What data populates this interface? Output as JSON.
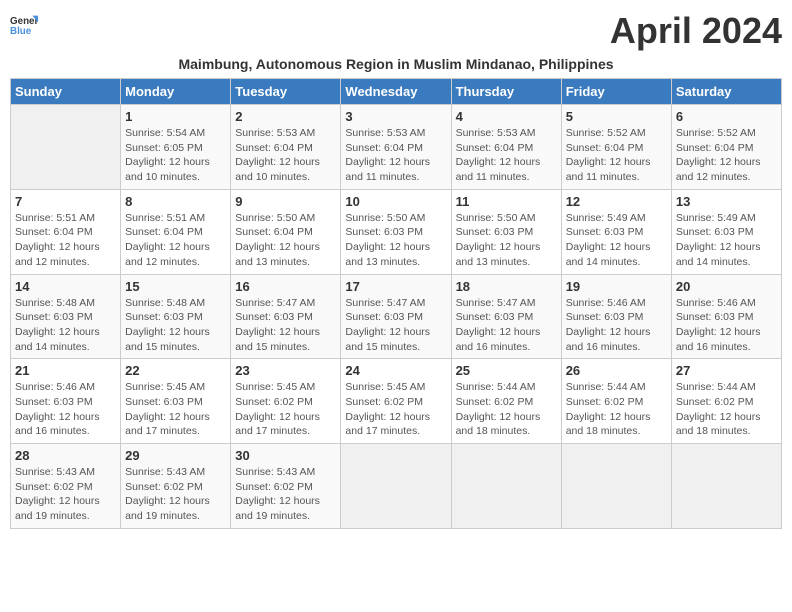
{
  "logo": {
    "line1": "General",
    "line2": "Blue"
  },
  "title": "April 2024",
  "subtitle": "Maimbung, Autonomous Region in Muslim Mindanao, Philippines",
  "days_header": [
    "Sunday",
    "Monday",
    "Tuesday",
    "Wednesday",
    "Thursday",
    "Friday",
    "Saturday"
  ],
  "weeks": [
    [
      {
        "day": "",
        "sunrise": "",
        "sunset": "",
        "daylight": ""
      },
      {
        "day": "1",
        "sunrise": "Sunrise: 5:54 AM",
        "sunset": "Sunset: 6:05 PM",
        "daylight": "Daylight: 12 hours and 10 minutes."
      },
      {
        "day": "2",
        "sunrise": "Sunrise: 5:53 AM",
        "sunset": "Sunset: 6:04 PM",
        "daylight": "Daylight: 12 hours and 10 minutes."
      },
      {
        "day": "3",
        "sunrise": "Sunrise: 5:53 AM",
        "sunset": "Sunset: 6:04 PM",
        "daylight": "Daylight: 12 hours and 11 minutes."
      },
      {
        "day": "4",
        "sunrise": "Sunrise: 5:53 AM",
        "sunset": "Sunset: 6:04 PM",
        "daylight": "Daylight: 12 hours and 11 minutes."
      },
      {
        "day": "5",
        "sunrise": "Sunrise: 5:52 AM",
        "sunset": "Sunset: 6:04 PM",
        "daylight": "Daylight: 12 hours and 11 minutes."
      },
      {
        "day": "6",
        "sunrise": "Sunrise: 5:52 AM",
        "sunset": "Sunset: 6:04 PM",
        "daylight": "Daylight: 12 hours and 12 minutes."
      }
    ],
    [
      {
        "day": "7",
        "sunrise": "Sunrise: 5:51 AM",
        "sunset": "Sunset: 6:04 PM",
        "daylight": "Daylight: 12 hours and 12 minutes."
      },
      {
        "day": "8",
        "sunrise": "Sunrise: 5:51 AM",
        "sunset": "Sunset: 6:04 PM",
        "daylight": "Daylight: 12 hours and 12 minutes."
      },
      {
        "day": "9",
        "sunrise": "Sunrise: 5:50 AM",
        "sunset": "Sunset: 6:04 PM",
        "daylight": "Daylight: 12 hours and 13 minutes."
      },
      {
        "day": "10",
        "sunrise": "Sunrise: 5:50 AM",
        "sunset": "Sunset: 6:03 PM",
        "daylight": "Daylight: 12 hours and 13 minutes."
      },
      {
        "day": "11",
        "sunrise": "Sunrise: 5:50 AM",
        "sunset": "Sunset: 6:03 PM",
        "daylight": "Daylight: 12 hours and 13 minutes."
      },
      {
        "day": "12",
        "sunrise": "Sunrise: 5:49 AM",
        "sunset": "Sunset: 6:03 PM",
        "daylight": "Daylight: 12 hours and 14 minutes."
      },
      {
        "day": "13",
        "sunrise": "Sunrise: 5:49 AM",
        "sunset": "Sunset: 6:03 PM",
        "daylight": "Daylight: 12 hours and 14 minutes."
      }
    ],
    [
      {
        "day": "14",
        "sunrise": "Sunrise: 5:48 AM",
        "sunset": "Sunset: 6:03 PM",
        "daylight": "Daylight: 12 hours and 14 minutes."
      },
      {
        "day": "15",
        "sunrise": "Sunrise: 5:48 AM",
        "sunset": "Sunset: 6:03 PM",
        "daylight": "Daylight: 12 hours and 15 minutes."
      },
      {
        "day": "16",
        "sunrise": "Sunrise: 5:47 AM",
        "sunset": "Sunset: 6:03 PM",
        "daylight": "Daylight: 12 hours and 15 minutes."
      },
      {
        "day": "17",
        "sunrise": "Sunrise: 5:47 AM",
        "sunset": "Sunset: 6:03 PM",
        "daylight": "Daylight: 12 hours and 15 minutes."
      },
      {
        "day": "18",
        "sunrise": "Sunrise: 5:47 AM",
        "sunset": "Sunset: 6:03 PM",
        "daylight": "Daylight: 12 hours and 16 minutes."
      },
      {
        "day": "19",
        "sunrise": "Sunrise: 5:46 AM",
        "sunset": "Sunset: 6:03 PM",
        "daylight": "Daylight: 12 hours and 16 minutes."
      },
      {
        "day": "20",
        "sunrise": "Sunrise: 5:46 AM",
        "sunset": "Sunset: 6:03 PM",
        "daylight": "Daylight: 12 hours and 16 minutes."
      }
    ],
    [
      {
        "day": "21",
        "sunrise": "Sunrise: 5:46 AM",
        "sunset": "Sunset: 6:03 PM",
        "daylight": "Daylight: 12 hours and 16 minutes."
      },
      {
        "day": "22",
        "sunrise": "Sunrise: 5:45 AM",
        "sunset": "Sunset: 6:03 PM",
        "daylight": "Daylight: 12 hours and 17 minutes."
      },
      {
        "day": "23",
        "sunrise": "Sunrise: 5:45 AM",
        "sunset": "Sunset: 6:02 PM",
        "daylight": "Daylight: 12 hours and 17 minutes."
      },
      {
        "day": "24",
        "sunrise": "Sunrise: 5:45 AM",
        "sunset": "Sunset: 6:02 PM",
        "daylight": "Daylight: 12 hours and 17 minutes."
      },
      {
        "day": "25",
        "sunrise": "Sunrise: 5:44 AM",
        "sunset": "Sunset: 6:02 PM",
        "daylight": "Daylight: 12 hours and 18 minutes."
      },
      {
        "day": "26",
        "sunrise": "Sunrise: 5:44 AM",
        "sunset": "Sunset: 6:02 PM",
        "daylight": "Daylight: 12 hours and 18 minutes."
      },
      {
        "day": "27",
        "sunrise": "Sunrise: 5:44 AM",
        "sunset": "Sunset: 6:02 PM",
        "daylight": "Daylight: 12 hours and 18 minutes."
      }
    ],
    [
      {
        "day": "28",
        "sunrise": "Sunrise: 5:43 AM",
        "sunset": "Sunset: 6:02 PM",
        "daylight": "Daylight: 12 hours and 19 minutes."
      },
      {
        "day": "29",
        "sunrise": "Sunrise: 5:43 AM",
        "sunset": "Sunset: 6:02 PM",
        "daylight": "Daylight: 12 hours and 19 minutes."
      },
      {
        "day": "30",
        "sunrise": "Sunrise: 5:43 AM",
        "sunset": "Sunset: 6:02 PM",
        "daylight": "Daylight: 12 hours and 19 minutes."
      },
      {
        "day": "",
        "sunrise": "",
        "sunset": "",
        "daylight": ""
      },
      {
        "day": "",
        "sunrise": "",
        "sunset": "",
        "daylight": ""
      },
      {
        "day": "",
        "sunrise": "",
        "sunset": "",
        "daylight": ""
      },
      {
        "day": "",
        "sunrise": "",
        "sunset": "",
        "daylight": ""
      }
    ]
  ]
}
